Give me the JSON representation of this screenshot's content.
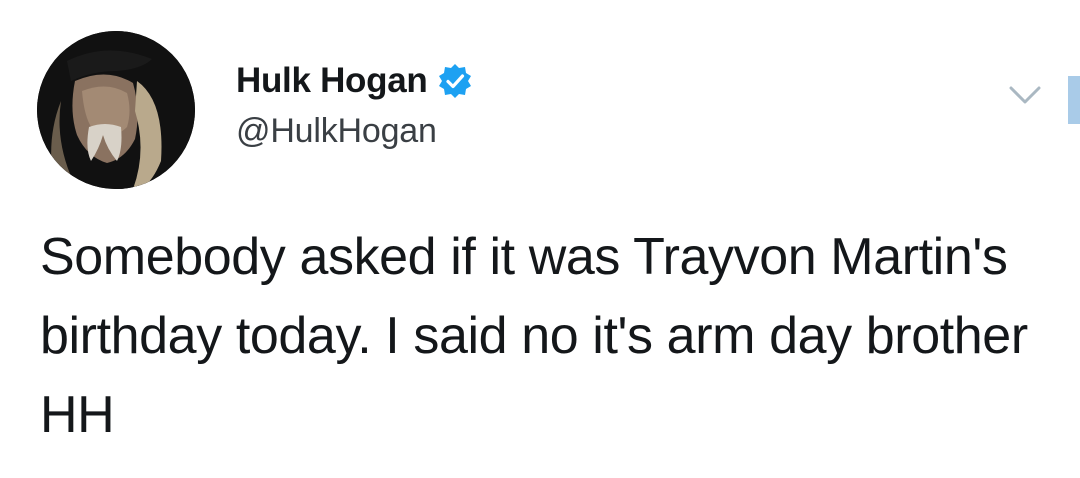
{
  "tweet": {
    "author": {
      "display_name": "Hulk Hogan",
      "handle": "@HulkHogan",
      "verified": true,
      "avatar_icon": "profile-photo"
    },
    "text": "Somebody asked if it was Trayvon Martin's birthday today. I said no it's arm day brother HH",
    "menu_icon": "chevron-down-icon",
    "colors": {
      "name": "#14171a",
      "handle": "#3a3f44",
      "verified_badge": "#1da1f2",
      "text": "#14171a",
      "chevron": "#aab8c2"
    }
  }
}
